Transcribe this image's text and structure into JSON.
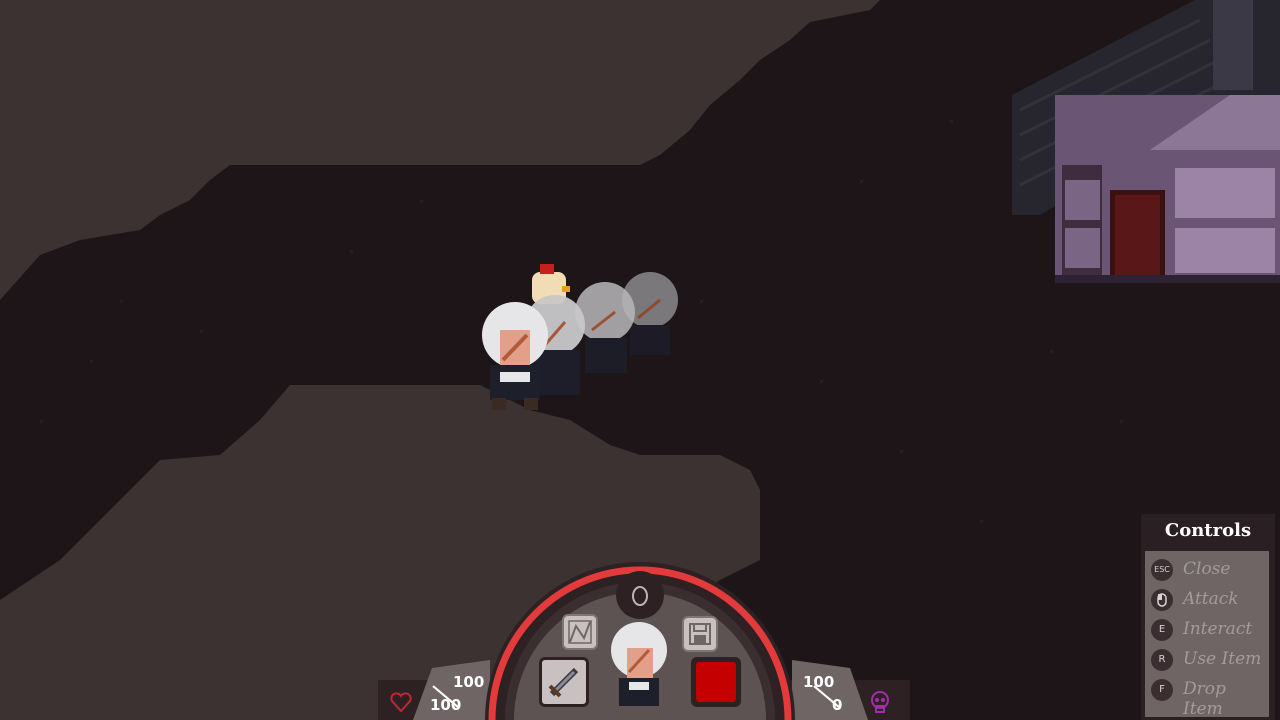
{
  "controls": {
    "title": "Controls",
    "items": [
      {
        "key": "ESC",
        "label": "Close"
      },
      {
        "key": "mouse",
        "label": "Attack"
      },
      {
        "key": "E",
        "label": "Interact"
      },
      {
        "key": "R",
        "label": "Use Item"
      },
      {
        "key": "F",
        "label": "Drop Item"
      }
    ]
  },
  "hud": {
    "health": {
      "current": "100",
      "max": "100"
    },
    "energy": {
      "current": "100",
      "max": "0"
    },
    "slots": {
      "top_left_icon": "map-icon",
      "top_right_icon": "save-icon",
      "top_center_icon": "egg-icon",
      "weapon_icon": "sword-icon",
      "item_color": "#c50000"
    },
    "left_icon": "heart-icon",
    "right_icon": "skull-icon",
    "ring_color": "#e33b3b"
  },
  "colors": {
    "ground": "#3b3231",
    "path": "#1e1519",
    "house_wall": "#6a5574",
    "house_roof": "#27262f"
  }
}
